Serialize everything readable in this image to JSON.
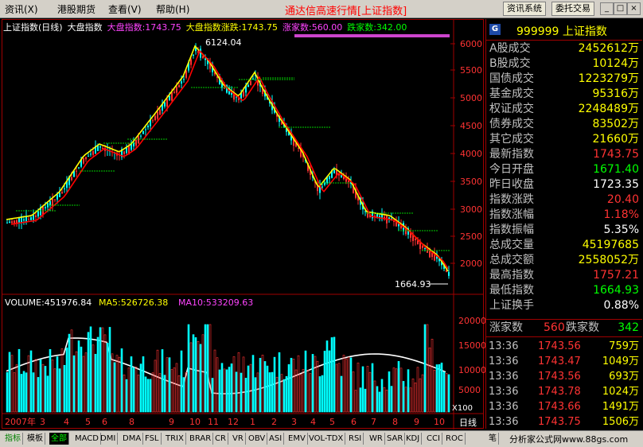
{
  "menu": {
    "items": [
      "资讯(X)",
      "港股期货",
      "查看(V)",
      "帮助(H)"
    ],
    "app_title": "通达信高速行情[上证指数]",
    "buttons": [
      "资讯系统",
      "委托交易"
    ],
    "window_controls": [
      "_",
      "□",
      "×"
    ]
  },
  "chart_header": {
    "name": "上证指数(日线)",
    "market": "大盘指数",
    "index_label": "大盘指数:1743.75",
    "index_change_label": "大盘指数涨跌:1743.75",
    "up_count_label": "涨家数:560.00",
    "down_count_label": "跌家数:342.00",
    "high_marker": "6124.04",
    "low_marker": "1664.93"
  },
  "volume_header": {
    "volume": "VOLUME:451976.84",
    "ma5": "MA5:526726.38",
    "ma10": "MA10:533209.63"
  },
  "price_axis": [
    "6000",
    "5500",
    "5000",
    "4500",
    "4000",
    "3500",
    "3000",
    "2500",
    "2000"
  ],
  "volume_axis": [
    "20000",
    "15000",
    "10000",
    "5000"
  ],
  "volume_unit": "X100",
  "date_axis": [
    "2007年",
    "3",
    "4",
    "5",
    "6",
    "8",
    "9",
    "10",
    "11",
    "12",
    "1",
    "2",
    "3",
    "4",
    "5",
    "6",
    "7",
    "8",
    "9",
    "10"
  ],
  "period_label": "日线",
  "colors": {
    "up": "#ff3333",
    "down": "#00ffff",
    "ma5": "#ffff00",
    "ma10": "#ff0000",
    "frame": "#a00000"
  },
  "panel": {
    "logo": "G",
    "code": "999999 上证指数",
    "rows": [
      {
        "label": "A股成交",
        "value": "2452612万",
        "color": "#ffff00"
      },
      {
        "label": "B股成交",
        "value": "10124万",
        "color": "#ffff00"
      },
      {
        "label": "国债成交",
        "value": "1223279万",
        "color": "#ffff00"
      },
      {
        "label": "基金成交",
        "value": "95316万",
        "color": "#ffff00"
      },
      {
        "label": "权证成交",
        "value": "2248489万",
        "color": "#ffff00"
      },
      {
        "label": "债券成交",
        "value": "83502万",
        "color": "#ffff00"
      },
      {
        "label": "其它成交",
        "value": "21660万",
        "color": "#ffff00"
      },
      {
        "label": "最新指数",
        "value": "1743.75",
        "color": "#ff3333"
      },
      {
        "label": "今日开盘",
        "value": "1671.40",
        "color": "#00ff00"
      },
      {
        "label": "昨日收盘",
        "value": "1723.35",
        "color": "#ffffff"
      },
      {
        "label": "指数涨跌",
        "value": "20.40",
        "color": "#ff3333"
      },
      {
        "label": "指数涨幅",
        "value": "1.18%",
        "color": "#ff3333"
      },
      {
        "label": "指数振幅",
        "value": "5.35%",
        "color": "#ffffff"
      },
      {
        "label": "总成交量",
        "value": "45197685",
        "color": "#ffff00"
      },
      {
        "label": "总成交额",
        "value": "2558052万",
        "color": "#ffff00"
      },
      {
        "label": "最高指数",
        "value": "1757.21",
        "color": "#ff3333"
      },
      {
        "label": "最低指数",
        "value": "1664.93",
        "color": "#00ff00"
      },
      {
        "label": "上证换手",
        "value": "0.88%",
        "color": "#ffffff"
      }
    ],
    "breadth": {
      "up_label": "涨家数",
      "up_value": "560",
      "down_label": "跌家数",
      "down_value": "342"
    },
    "ticks": [
      {
        "time": "13:36",
        "price": "1743.56",
        "vol": "759万"
      },
      {
        "time": "13:36",
        "price": "1743.47",
        "vol": "1049万"
      },
      {
        "time": "13:36",
        "price": "1743.56",
        "vol": "693万"
      },
      {
        "time": "13:36",
        "price": "1743.78",
        "vol": "1024万"
      },
      {
        "time": "13:36",
        "price": "1743.66",
        "vol": "1491万"
      },
      {
        "time": "13:36",
        "price": "1743.75",
        "vol": "1506万"
      }
    ]
  },
  "tabs": [
    "指标",
    "模板",
    "全部",
    "MACD",
    "DMI",
    "DMA",
    "FSL",
    "TRIX",
    "BRAR",
    "CR",
    "VR",
    "OBV",
    "ASI",
    "EMV",
    "VOL-TDX",
    "RSI",
    "WR",
    "SAR",
    "KDJ",
    "CCI",
    "ROC"
  ],
  "tab_extra": "笔",
  "watermark": "分析家公式网www.88gs.com"
}
